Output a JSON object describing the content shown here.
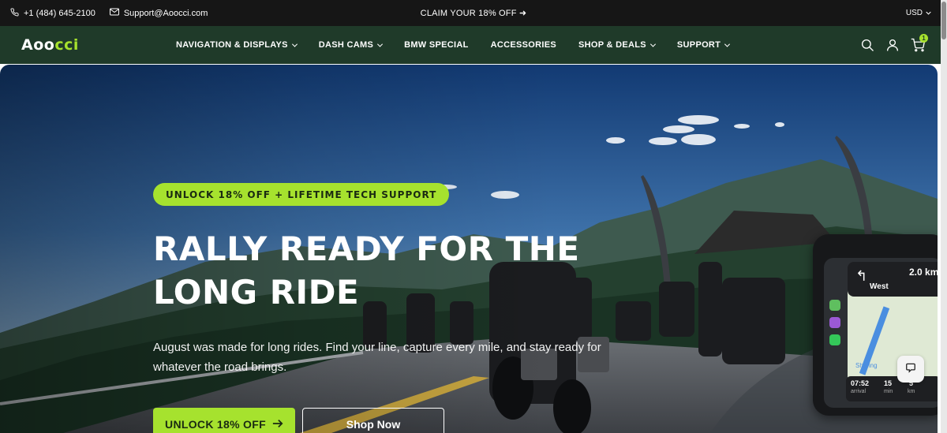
{
  "topbar": {
    "phone": "+1 (484) 645-2100",
    "email": "Support@Aoocci.com",
    "promo": "CLAIM YOUR 18% OFF ➜",
    "currency": "USD"
  },
  "navbar": {
    "logo_left": "Aoo",
    "logo_right": "cci",
    "links": [
      {
        "label": "NAVIGATION & DISPLAYS",
        "dropdown": true
      },
      {
        "label": "DASH CAMS",
        "dropdown": true
      },
      {
        "label": "BMW SPECIAL",
        "dropdown": false
      },
      {
        "label": "ACCESSORIES",
        "dropdown": false
      },
      {
        "label": "SHOP & DEALS",
        "dropdown": true
      },
      {
        "label": "SUPPORT",
        "dropdown": true
      }
    ],
    "icons": [
      "search-icon",
      "account-icon",
      "cart-icon"
    ],
    "cart_count": "1"
  },
  "hero": {
    "badge": "UNLOCK 18% OFF + LIFETIME TECH SUPPORT",
    "headline_line1": "RALLY READY FOR THE",
    "headline_line2": "LONG RIDE",
    "subtitle": "August was made for long rides. Find your line, capture every mile, and stay ready for whatever the road brings.",
    "primary_button": "UNLOCK 18% OFF",
    "secondary_button": "Shop Now"
  },
  "device_screen": {
    "distance": "2.0 km",
    "street": "West",
    "time": "07:52",
    "time_label": "arrival",
    "minutes": "15",
    "minutes_label": "min",
    "km": "5",
    "km_label": "km",
    "app": "Sharing"
  },
  "colors": {
    "accent": "#a6e22e",
    "nav_bg": "#1f3a29",
    "topbar_bg": "#161616"
  }
}
